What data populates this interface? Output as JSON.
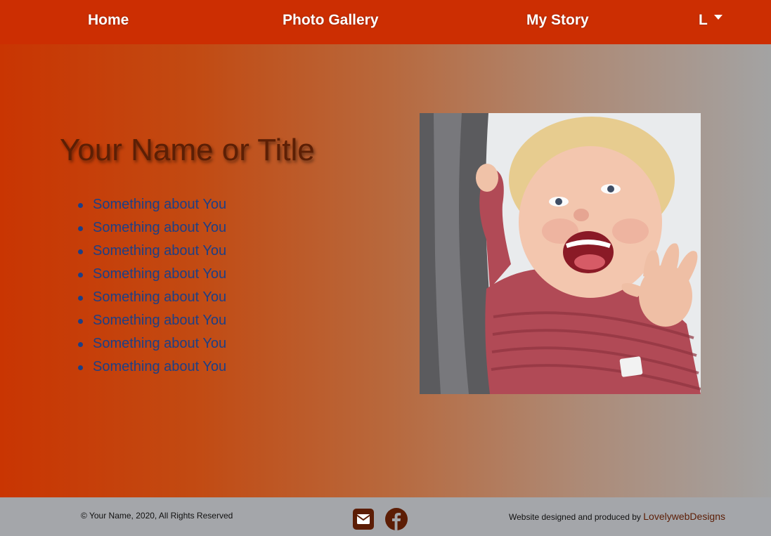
{
  "nav": {
    "home": "Home",
    "gallery": "Photo Gallery",
    "story": "My Story",
    "dropdown": "L"
  },
  "hero": {
    "title": "Your Name or Title",
    "items": [
      "Something about You",
      "Something about You",
      "Something about You",
      "Something about You",
      "Something about You",
      "Something about You",
      "Something about You",
      "Something about You"
    ]
  },
  "footer": {
    "copyright": "© Your Name, 2020, All Rights Reserved",
    "credit_text": "Website designed and produced by",
    "credit_link": "LovelywebDesigns"
  },
  "icons": {
    "dropdown": "caret-down-icon",
    "email": "envelope-icon",
    "facebook": "facebook-icon"
  },
  "colors": {
    "navbar": "#cc2e02",
    "title": "#5c1f05",
    "list_text": "#1d3f86",
    "footer_bg": "#a4a6aa",
    "icon_bg": "#5c1d05"
  }
}
